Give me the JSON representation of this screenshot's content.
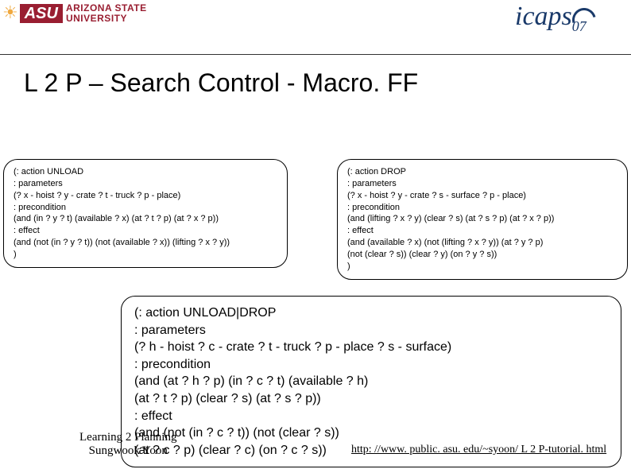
{
  "header": {
    "asu_initials": "ASU",
    "asu_name_line1": "ARIZONA STATE",
    "asu_name_line2": "UNIVERSITY",
    "conf_text": "icaps07"
  },
  "title": "L 2 P – Search Control - Macro. FF",
  "box_left": "(: action UNLOAD\n: parameters\n(? x - hoist ? y - crate ? t - truck ? p - place)\n: precondition\n(and (in ? y ? t) (available ? x) (at ? t ? p) (at ? x ? p))\n: effect\n(and (not (in ? y ? t)) (not (available ? x)) (lifting ? x ? y))\n)",
  "box_right": "(: action DROP\n: parameters\n(? x - hoist ? y - crate ? s - surface ? p - place)\n: precondition\n(and (lifting ? x ? y) (clear ? s) (at ? s ? p) (at ? x ? p))\n: effect\n(and (available ? x) (not (lifting ? x ? y)) (at ? y ? p)\n(not (clear ? s)) (clear ? y) (on ? y ? s))\n)",
  "box_bottom": "(: action UNLOAD|DROP\n: parameters\n(? h - hoist ? c - crate ? t - truck ? p - place ? s - surface)\n: precondition\n(and (at ? h ? p) (in ? c ? t) (available ? h)\n(at ? t ? p) (clear ? s) (at ? s ? p))\n: effect\n(and (not (in ? c ? t)) (not (clear ? s))\n(at ? c ? p) (clear ? c) (on ? c ? s))",
  "footer": {
    "line1": "Learning 2 Planning",
    "line2": "Sungwook Yoon",
    "link_text": "http: //www. public. asu. edu/~syoon/ L 2 P-tutorial. html"
  }
}
